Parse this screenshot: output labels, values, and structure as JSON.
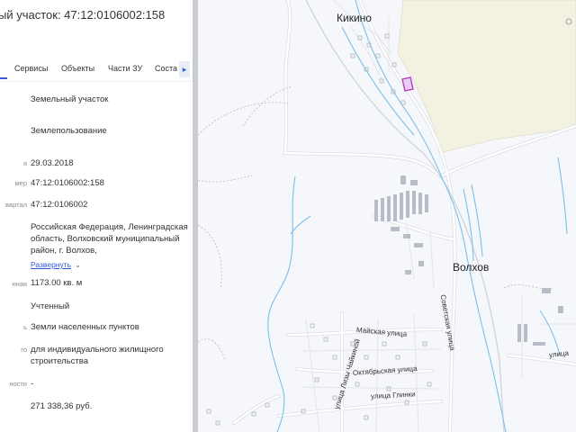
{
  "panel": {
    "title": "ый участок: 47:12:0106002:158",
    "tabs": [
      {
        "label": "Сервисы"
      },
      {
        "label": "Объекты"
      },
      {
        "label": "Части ЗУ"
      },
      {
        "label": "Соста"
      }
    ],
    "next_icon": "chevron-right-icon",
    "rows": [
      {
        "label": "",
        "value": "Земельный участок"
      },
      {
        "label": "",
        "value": "Землепользование"
      },
      {
        "label": "я",
        "value": "29.03.2018"
      },
      {
        "label": "мер",
        "value": "47:12:0106002:158"
      },
      {
        "label": "вартал",
        "value": "47:12:0106002"
      },
      {
        "label": "",
        "value": "Российская Федерация, Ленинградская область, Волховский муниципальный район, г. Волхов,"
      },
      {
        "label": "нная",
        "value": "1173.00 кв. м"
      },
      {
        "label": "",
        "value": "Учтенный"
      },
      {
        "label": "ь",
        "value": "Земли населенных пунктов"
      },
      {
        "label": "го",
        "value": "для индивидуального жилищного строительства"
      },
      {
        "label": "ности",
        "value": "-"
      },
      {
        "label": "",
        "value": "271 338,36 руб."
      }
    ],
    "expand_link": "Развернуть"
  },
  "map": {
    "places": [
      "Кикино",
      "Волхов"
    ],
    "streets": {
      "sovetskaya": "Советская улица",
      "mayskaya": "Майская улица",
      "oktyabrskaya": "Октябрьская улица",
      "chaikinoy": "улица Лизы Чайкиной",
      "glinki": "улица Глинки",
      "top_right": "улица"
    },
    "colors": {
      "field": "#f2f1e2",
      "river": "#7cc0e8",
      "road": "#dcdfe5",
      "parcel": "#b036b4",
      "building": "#b7bcc6"
    }
  }
}
